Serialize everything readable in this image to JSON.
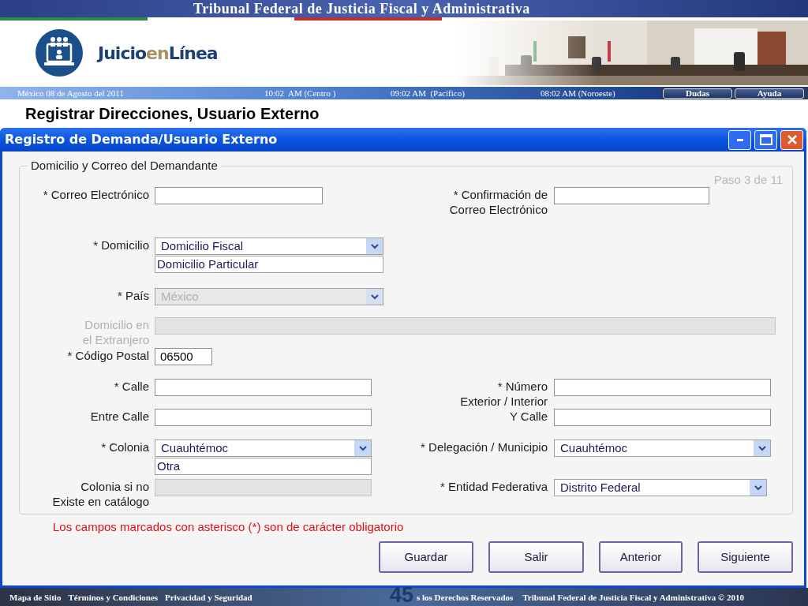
{
  "header": {
    "title": "Tribunal Federal de Justicia Fiscal y Administrativa",
    "logo": [
      {
        "text": "Juicio",
        "kind": "main"
      },
      {
        "text": "en",
        "kind": "accent"
      },
      {
        "text": "Línea",
        "kind": "main"
      }
    ]
  },
  "info_bar": {
    "items": [
      "México 08 de Agosto del 2011",
      "10:02  AM (Centro )",
      "09:02 AM  (Pacífico)",
      "08:02 AM (Noroeste)"
    ],
    "buttons": [
      "Dudas",
      "Ayuda"
    ]
  },
  "page_title": "Registrar Direcciones, Usuario Externo",
  "window": {
    "title": "Registro de Demanda/Usuario Externo",
    "controls": [
      {
        "kind": "minimize"
      },
      {
        "kind": "maximize"
      },
      {
        "kind": "close"
      }
    ]
  },
  "fieldset": {
    "legend": "Domicilio y Correo del Demandante",
    "step": "Paso 3 de 11",
    "rows": [
      {
        "left": {
          "label": "* Correo Electrónico",
          "label_disabled": false,
          "field": {
            "kind": "text",
            "disabled": false
          }
        },
        "right": {
          "label": "* Confirmación de\nCorreo Electrónico",
          "label_disabled": false,
          "field": {
            "kind": "text",
            "disabled": false
          }
        }
      },
      {
        "left": {
          "label": "* Domicilio",
          "label_disabled": false,
          "field": {
            "kind": "select",
            "value": "Domicilio Fiscal",
            "option": "Domicilio Particular",
            "disabled": false
          }
        }
      },
      {
        "left": {
          "label": "* País",
          "label_disabled": false,
          "field": {
            "kind": "select",
            "value": "México",
            "disabled": true
          }
        }
      },
      {
        "left": {
          "label": "Domicilio en\nel Extranjero",
          "label_disabled": true,
          "field": {
            "kind": "text",
            "disabled": true
          }
        }
      },
      {
        "left": {
          "label": "* Código Postal",
          "label_disabled": false,
          "field": {
            "kind": "text",
            "value": "06500",
            "disabled": false
          }
        }
      },
      {
        "left": {
          "label": "* Calle",
          "label_disabled": false,
          "field": {
            "kind": "text",
            "disabled": false
          }
        },
        "right": {
          "label": "* Número\nExterior / Interior",
          "label_disabled": false,
          "field": {
            "kind": "text",
            "disabled": false
          }
        }
      },
      {
        "left": {
          "label": "Entre Calle",
          "label_disabled": false,
          "field": {
            "kind": "text",
            "disabled": false
          }
        },
        "right": {
          "label": "Y Calle",
          "label_disabled": false,
          "field": {
            "kind": "text",
            "disabled": false
          }
        }
      },
      {
        "left": {
          "label": "* Colonia",
          "label_disabled": false,
          "field": {
            "kind": "select",
            "value": "Cuauhtémoc",
            "option": "Otra",
            "disabled": false
          }
        },
        "right": {
          "label": "* Delegación / Municipio",
          "label_disabled": false,
          "field": {
            "kind": "select",
            "value": "Cuauhtémoc",
            "disabled": false
          }
        }
      },
      {
        "left": {
          "label": "Colonia si no\nExiste en catálogo",
          "label_disabled": false,
          "field": {
            "kind": "text",
            "disabled": true
          }
        },
        "right": {
          "label": "* Entidad Federativa",
          "label_disabled": false,
          "field": {
            "kind": "select",
            "value": "Distrito Federal",
            "disabled": false
          }
        }
      }
    ]
  },
  "note": "Los campos marcados con asterisco (*) son de carácter obligatorio",
  "buttons": [
    "Guardar",
    "Salir",
    "Anterior",
    "Siguiente"
  ],
  "footer": {
    "links": [
      "Mapa de Sitio",
      "Términos y Condiciones",
      "Privacidad y Seguridad"
    ],
    "page_number": "45",
    "texts": [
      "s los Derechos Reservados",
      "Tribunal Federal de Justicia Fiscal y Administrativa © 2010"
    ]
  }
}
